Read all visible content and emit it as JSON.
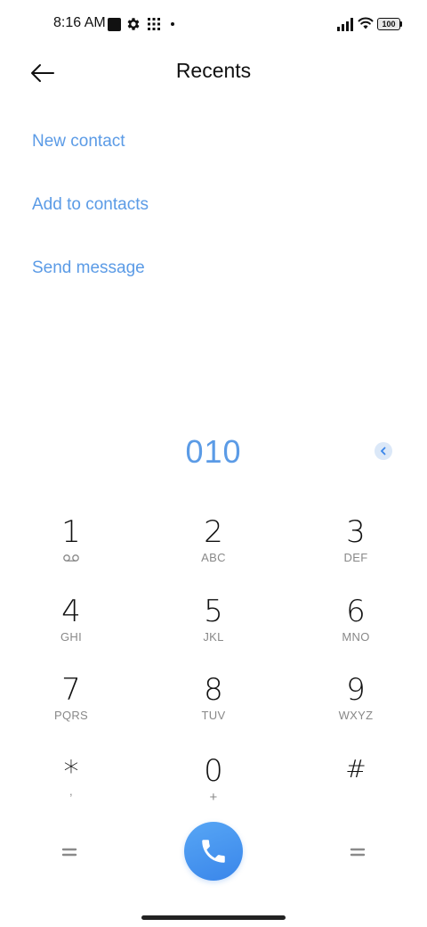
{
  "status_bar": {
    "time": "8:16 AM",
    "battery": "100"
  },
  "header": {
    "title": "Recents"
  },
  "actions": {
    "new_contact": "New contact",
    "add_to_contacts": "Add to contacts",
    "send_message": "Send message"
  },
  "dialer": {
    "number": "010"
  },
  "keypad": {
    "k1": {
      "digit": "1",
      "icon": "voicemail-icon"
    },
    "k2": {
      "digit": "2",
      "letters": "ABC"
    },
    "k3": {
      "digit": "3",
      "letters": "DEF"
    },
    "k4": {
      "digit": "4",
      "letters": "GHI"
    },
    "k5": {
      "digit": "5",
      "letters": "JKL"
    },
    "k6": {
      "digit": "6",
      "letters": "MNO"
    },
    "k7": {
      "digit": "7",
      "letters": "PQRS"
    },
    "k8": {
      "digit": "8",
      "letters": "TUV"
    },
    "k9": {
      "digit": "9",
      "letters": "WXYZ"
    },
    "kstar": {
      "digit": "*",
      "letters": ","
    },
    "k0": {
      "digit": "0",
      "letters": "+"
    },
    "khash": {
      "digit": "#",
      "letters": ""
    }
  },
  "colors": {
    "accent": "#5b9be6",
    "call_button": "#3a86ea"
  }
}
